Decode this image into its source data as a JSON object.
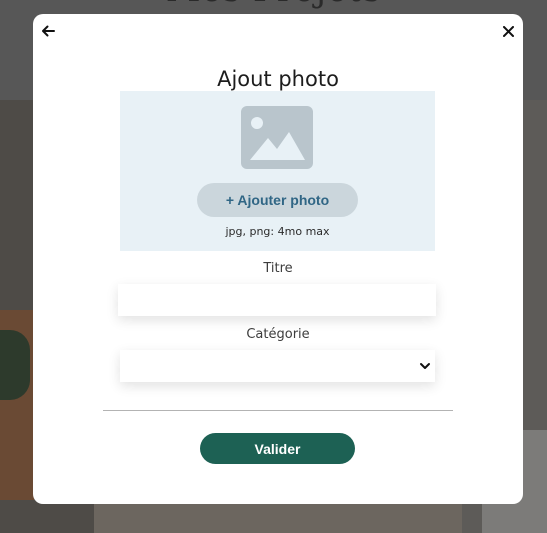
{
  "background": {
    "page_title": "Mes Projets"
  },
  "modal": {
    "title": "Ajout photo",
    "back_icon": "arrow-left-icon",
    "close_icon": "close-icon",
    "upload": {
      "icon": "image-icon",
      "button_label": "+ Ajouter photo",
      "hint": "jpg, png: 4mo max"
    },
    "title_field": {
      "label": "Titre",
      "value": ""
    },
    "category_field": {
      "label": "Catégorie",
      "selected": "",
      "chevron_icon": "chevron-down-icon"
    },
    "submit_label": "Valider"
  },
  "colors": {
    "accent_green": "#1d6154",
    "upload_bg": "#e8f1f6",
    "upload_button_bg": "#cbd6dc",
    "upload_button_text": "#306685"
  }
}
